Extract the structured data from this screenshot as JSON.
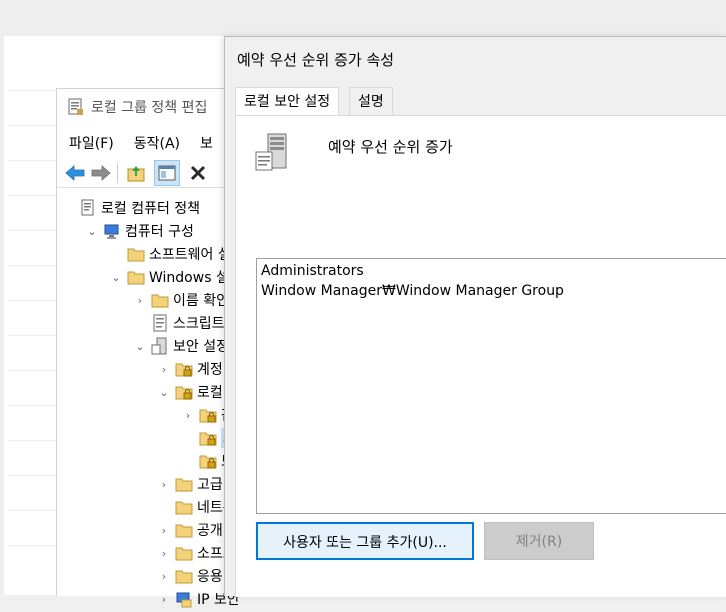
{
  "gpedit": {
    "title": "로컬 그룹 정책 편집",
    "menu": [
      "파일(F)",
      "동작(A)",
      "보"
    ],
    "tree": [
      {
        "label": "로컬 컴퓨터 정책",
        "level": 0,
        "expander": "",
        "icon": "policy-doc-icon"
      },
      {
        "label": "컴퓨터 구성",
        "level": 1,
        "expander": "v",
        "icon": "computer-icon"
      },
      {
        "label": "소프트웨어 설",
        "level": 2,
        "expander": "",
        "icon": "folder-icon"
      },
      {
        "label": "Windows 설정",
        "level": 2,
        "expander": "v",
        "icon": "folder-icon"
      },
      {
        "label": "이름 확인",
        "level": 3,
        "expander": ">",
        "icon": "folder-icon"
      },
      {
        "label": "스크립트",
        "level": 3,
        "expander": "",
        "icon": "script-icon"
      },
      {
        "label": "보안 설정",
        "level": 3,
        "expander": "v",
        "icon": "security-icon"
      },
      {
        "label": "계정 정",
        "level": 4,
        "expander": ">",
        "icon": "locked-folder-icon"
      },
      {
        "label": "로컬 정",
        "level": 4,
        "expander": "v",
        "icon": "locked-folder-icon"
      },
      {
        "label": "감",
        "level": 5,
        "expander": ">",
        "icon": "locked-folder-icon"
      },
      {
        "label": "사",
        "level": 5,
        "expander": "",
        "icon": "locked-folder-icon",
        "selected": true
      },
      {
        "label": "보",
        "level": 5,
        "expander": "",
        "icon": "locked-folder-icon"
      },
      {
        "label": "고급 보",
        "level": 4,
        "expander": ">",
        "icon": "folder-icon"
      },
      {
        "label": "네트워",
        "level": 4,
        "expander": "",
        "icon": "folder-icon"
      },
      {
        "label": "공개 키",
        "level": 4,
        "expander": ">",
        "icon": "folder-icon"
      },
      {
        "label": "소프트",
        "level": 4,
        "expander": ">",
        "icon": "folder-icon"
      },
      {
        "label": "응용 프",
        "level": 4,
        "expander": ">",
        "icon": "folder-icon"
      },
      {
        "label": "IP 보안",
        "level": 4,
        "expander": ">",
        "icon": "ip-security-icon"
      }
    ]
  },
  "dialog": {
    "title": "예약 우선 순위 증가 속성",
    "tabs": [
      {
        "label": "로컬 보안 설정",
        "active": true
      },
      {
        "label": "설명",
        "active": false
      }
    ],
    "policy_name": "예약 우선 순위 증가",
    "members": [
      "Administrators",
      "Window Manager₩Window Manager Group"
    ],
    "add_button": "사용자 또는 그룹 추가(U)...",
    "remove_button": "제거(R)"
  },
  "colors": {
    "accent": "#0078d7",
    "selection": "#cce8ff",
    "folder": "#f3d27a",
    "lock": "#d4a017"
  }
}
